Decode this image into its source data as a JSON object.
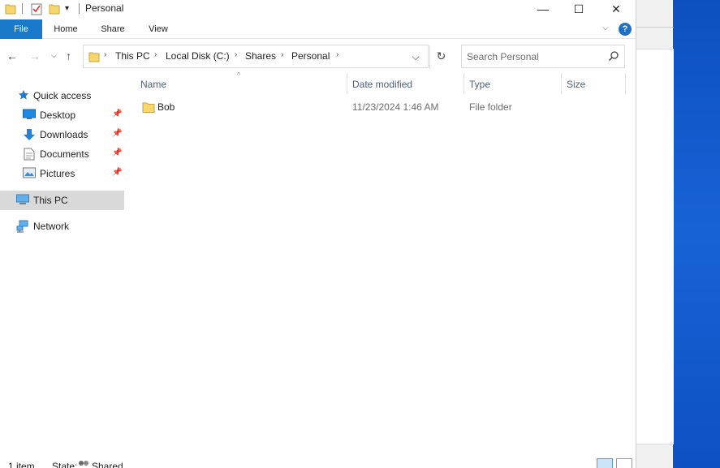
{
  "window": {
    "title": "Personal",
    "controls": {
      "minimize": "—",
      "maximize": "☐",
      "close": "✕"
    }
  },
  "ribbon": {
    "tabs": [
      {
        "label": "File",
        "active": true
      },
      {
        "label": "Home"
      },
      {
        "label": "Share"
      },
      {
        "label": "View"
      }
    ],
    "help_label": "?"
  },
  "address_bar": {
    "breadcrumbs": [
      "This PC",
      "Local Disk (C:)",
      "Shares",
      "Personal"
    ],
    "refresh_icon": "refresh-icon"
  },
  "search": {
    "placeholder": "Search Personal"
  },
  "nav_pane": {
    "quick_access": "Quick access",
    "pinned": [
      {
        "label": "Desktop",
        "icon": "desktop-icon"
      },
      {
        "label": "Downloads",
        "icon": "downloads-icon"
      },
      {
        "label": "Documents",
        "icon": "documents-icon"
      },
      {
        "label": "Pictures",
        "icon": "pictures-icon"
      }
    ],
    "this_pc": "This PC",
    "network": "Network"
  },
  "file_list": {
    "columns": [
      "Name",
      "Date modified",
      "Type",
      "Size"
    ],
    "rows": [
      {
        "name": "Bob",
        "date_modified": "11/23/2024 1:46 AM",
        "type": "File folder",
        "size": ""
      }
    ]
  },
  "status_bar": {
    "item_count": "1 item",
    "state_label": "State:",
    "state_value": "Shared"
  },
  "colors": {
    "file_tab": "#1979ca",
    "selected_nav": "#d9d9d9",
    "column_header_text": "#4c607a",
    "folder_yellow": "#f7d66b",
    "desktop_blue": "#1763d6"
  }
}
